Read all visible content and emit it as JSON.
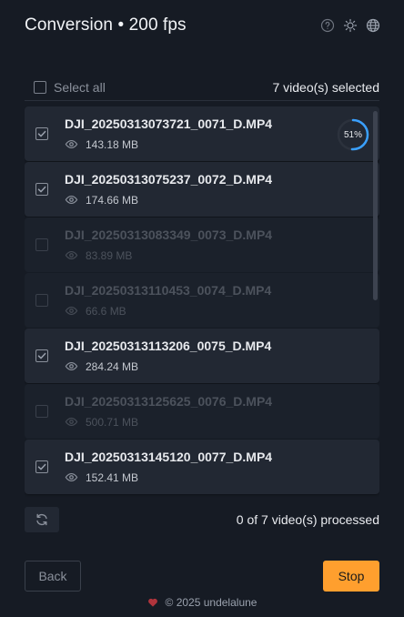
{
  "header": {
    "title": "Conversion • 200 fps",
    "icons": [
      "help-icon",
      "sun-icon",
      "globe-icon"
    ]
  },
  "selection": {
    "select_all_label": "Select all",
    "selected_count": "7 video(s) selected"
  },
  "videos": [
    {
      "name": "DJI_20250313073721_0071_D.MP4",
      "size": "143.18 MB",
      "selected": true,
      "progress": "51%",
      "progress_value": 0.51
    },
    {
      "name": "DJI_20250313075237_0072_D.MP4",
      "size": "174.66 MB",
      "selected": true
    },
    {
      "name": "DJI_20250313083349_0073_D.MP4",
      "size": "83.89 MB",
      "selected": false
    },
    {
      "name": "DJI_20250313110453_0074_D.MP4",
      "size": "66.6 MB",
      "selected": false
    },
    {
      "name": "DJI_20250313113206_0075_D.MP4",
      "size": "284.24 MB",
      "selected": true
    },
    {
      "name": "DJI_20250313125625_0076_D.MP4",
      "size": "500.71 MB",
      "selected": false
    },
    {
      "name": "DJI_20250313145120_0077_D.MP4",
      "size": "152.41 MB",
      "selected": true
    }
  ],
  "status": {
    "processed": "0 of 7 video(s) processed"
  },
  "buttons": {
    "back": "Back",
    "stop": "Stop"
  },
  "footer": {
    "copyright": "© 2025 undelalune"
  },
  "colors": {
    "accent": "#ff9f2e",
    "progress": "#3aa0ff",
    "background": "#161b24",
    "heart": "#b0343c"
  }
}
